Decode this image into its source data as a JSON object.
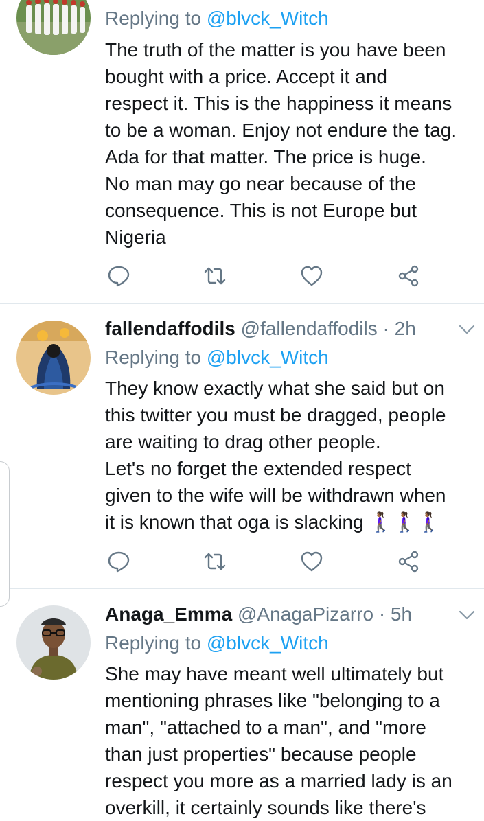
{
  "tweets": [
    {
      "replying_prefix": "Replying to",
      "replying_to": "@blvck_Witch",
      "lines": [
        "The truth of the matter is you have been",
        "bought with a price. Accept it and",
        "respect it. This is the happiness it means",
        "to be a woman. Enjoy not endure the tag.",
        "Ada for that matter. The price is huge.",
        "No man may go near because of the",
        "consequence. This is not Europe but",
        "Nigeria"
      ],
      "avatar_icon": "group-photo-avatar"
    },
    {
      "name": "fallendaffodils",
      "handle": "@fallendaffodils",
      "time": "· 2h",
      "replying_prefix": "Replying to",
      "replying_to": "@blvck_Witch",
      "lines": [
        "They know exactly what she said but on",
        "this twitter you must be dragged, people",
        "are waiting to drag other people.",
        "Let's no forget the extended respect",
        "given to the wife will be withdrawn when",
        "it is known that oga is slacking"
      ],
      "emoji": "🚶🏾‍♀️🚶🏾‍♀️🚶🏾‍♀️",
      "avatar_icon": "artwork-avatar"
    },
    {
      "name": "Anaga_Emma",
      "handle": "@AnagaPizarro",
      "time": "· 5h",
      "replying_prefix": "Replying to",
      "replying_to": "@blvck_Witch",
      "lines": [
        "She may have meant well ultimately but",
        "mentioning phrases like \"belonging to a",
        "man\", \"attached to a man\", and \"more",
        "than just properties\" because people",
        "respect you more as a married lady is an",
        "overkill, it certainly sounds like there's"
      ],
      "avatar_icon": "person-photo-avatar"
    }
  ],
  "icons": {
    "reply": "reply-icon",
    "retweet": "retweet-icon",
    "like": "heart-icon",
    "share": "share-icon",
    "more": "chevron-down-icon"
  },
  "colors": {
    "text": "#14171a",
    "secondary": "#657786",
    "link": "#1da1f2",
    "divider": "#e1e8ed"
  }
}
